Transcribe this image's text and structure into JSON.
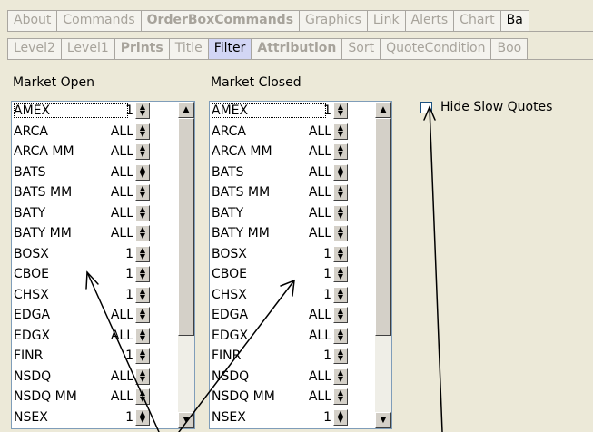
{
  "tabs_top": [
    {
      "label": "About",
      "bold": false
    },
    {
      "label": "Commands",
      "bold": false
    },
    {
      "label": "OrderBoxCommands",
      "bold": true
    },
    {
      "label": "Graphics",
      "bold": false
    },
    {
      "label": "Link",
      "bold": false
    },
    {
      "label": "Alerts",
      "bold": false
    },
    {
      "label": "Chart",
      "bold": false
    },
    {
      "label": "Ba",
      "bold": false,
      "cut": true
    }
  ],
  "tabs_bottom": [
    {
      "label": "Level2",
      "bold": false
    },
    {
      "label": "Level1",
      "bold": false
    },
    {
      "label": "Prints",
      "bold": true
    },
    {
      "label": "Title",
      "bold": false
    },
    {
      "label": "Filter",
      "bold": false,
      "selected": true
    },
    {
      "label": "Attribution",
      "bold": true
    },
    {
      "label": "Sort",
      "bold": false
    },
    {
      "label": "QuoteCondition",
      "bold": false
    },
    {
      "label": "Boo",
      "bold": false
    }
  ],
  "market_open": {
    "title": "Market Open",
    "rows": [
      {
        "name": "AMEX",
        "value": "1"
      },
      {
        "name": "ARCA",
        "value": "ALL"
      },
      {
        "name": "ARCA MM",
        "value": "ALL"
      },
      {
        "name": "BATS",
        "value": "ALL"
      },
      {
        "name": "BATS MM",
        "value": "ALL"
      },
      {
        "name": "BATY",
        "value": "ALL"
      },
      {
        "name": "BATY MM",
        "value": "ALL"
      },
      {
        "name": "BOSX",
        "value": "1"
      },
      {
        "name": "CBOE",
        "value": "1"
      },
      {
        "name": "CHSX",
        "value": "1"
      },
      {
        "name": "EDGA",
        "value": "ALL"
      },
      {
        "name": "EDGX",
        "value": "ALL"
      },
      {
        "name": "FINR",
        "value": "1"
      },
      {
        "name": "NSDQ",
        "value": "ALL"
      },
      {
        "name": "NSDQ MM",
        "value": "ALL"
      },
      {
        "name": "NSEX",
        "value": "1"
      }
    ]
  },
  "market_closed": {
    "title": "Market Closed",
    "rows": [
      {
        "name": "AMEX",
        "value": "1"
      },
      {
        "name": "ARCA",
        "value": "ALL"
      },
      {
        "name": "ARCA MM",
        "value": "ALL"
      },
      {
        "name": "BATS",
        "value": "ALL"
      },
      {
        "name": "BATS MM",
        "value": "ALL"
      },
      {
        "name": "BATY",
        "value": "ALL"
      },
      {
        "name": "BATY MM",
        "value": "ALL"
      },
      {
        "name": "BOSX",
        "value": "1"
      },
      {
        "name": "CBOE",
        "value": "1"
      },
      {
        "name": "CHSX",
        "value": "1"
      },
      {
        "name": "EDGA",
        "value": "ALL"
      },
      {
        "name": "EDGX",
        "value": "ALL"
      },
      {
        "name": "FINR",
        "value": "1"
      },
      {
        "name": "NSDQ",
        "value": "ALL"
      },
      {
        "name": "NSDQ MM",
        "value": "ALL"
      },
      {
        "name": "NSEX",
        "value": "1"
      }
    ]
  },
  "hide_slow_quotes": {
    "label": "Hide Slow Quotes",
    "checked": false
  },
  "icons": {
    "spin_up": "▲",
    "spin_down": "▼",
    "scroll_up": "▲",
    "scroll_down": "▼"
  }
}
